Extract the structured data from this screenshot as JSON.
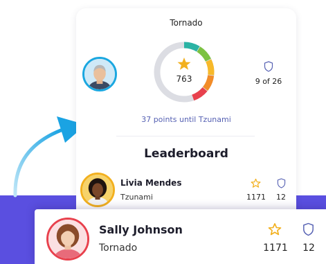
{
  "colors": {
    "purple_band": "#5a4fe0",
    "accent_text": "#5661b3",
    "star": "#f2b01e",
    "gauge_gray": "#dcdde3",
    "gauge_segments": [
      "#2bb3a4",
      "#7cc242",
      "#f7b92a",
      "#f28c28",
      "#e8414d"
    ]
  },
  "status_card": {
    "tier_name": "Tornado",
    "score": "763",
    "rank": "9 of 26",
    "points_message": "37 points until Tzunami",
    "gauge_progress": 0.45
  },
  "leaderboard": {
    "title": "Leaderboard",
    "rows": [
      {
        "name": "Livia Mendes",
        "tier": "Tzunami",
        "points": "1171",
        "badges": "12"
      }
    ]
  },
  "highlighted_row": {
    "name": "Sally Johnson",
    "tier": "Tornado",
    "points": "1171",
    "badges": "12"
  },
  "icons": [
    "star-icon",
    "shield-icon",
    "user-avatar",
    "curved-arrow-icon"
  ]
}
